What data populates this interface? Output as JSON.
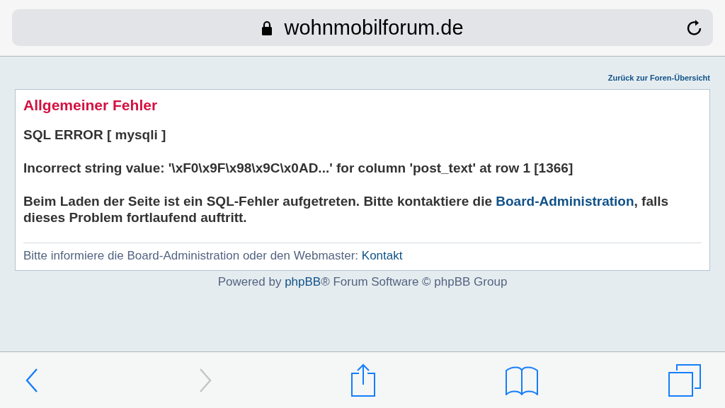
{
  "address_bar": {
    "url": "wohnmobilforum.de",
    "secure": true
  },
  "back_link": "Zurück zur Foren-Übersicht",
  "error_panel": {
    "title": "Allgemeiner Fehler",
    "paragraphs": [
      {
        "text": "SQL ERROR [ mysqli ]"
      },
      {
        "text": "Incorrect string value: '\\xF0\\x9F\\x98\\x9C\\x0AD...' for column 'post_text' at row 1 [1366]"
      },
      {
        "text": "Beim Laden der Seite ist ein SQL-Fehler aufgetreten. Bitte kontaktiere die ",
        "link": "Board-Administration",
        "after": ", falls dieses Problem fortlaufend auftritt."
      }
    ],
    "footer": {
      "text": "Bitte informiere die Board-Administration oder den Webmaster: ",
      "link": "Kontakt"
    }
  },
  "powered_by": {
    "before": "Powered by ",
    "link": "phpBB",
    "after": "® Forum Software © phpBB Group"
  },
  "toolbar": [
    {
      "kind": "back",
      "disabled": false
    },
    {
      "kind": "forward",
      "disabled": true
    },
    {
      "kind": "share",
      "disabled": false
    },
    {
      "kind": "bookmarks",
      "disabled": false
    },
    {
      "kind": "tabs",
      "disabled": false
    }
  ]
}
